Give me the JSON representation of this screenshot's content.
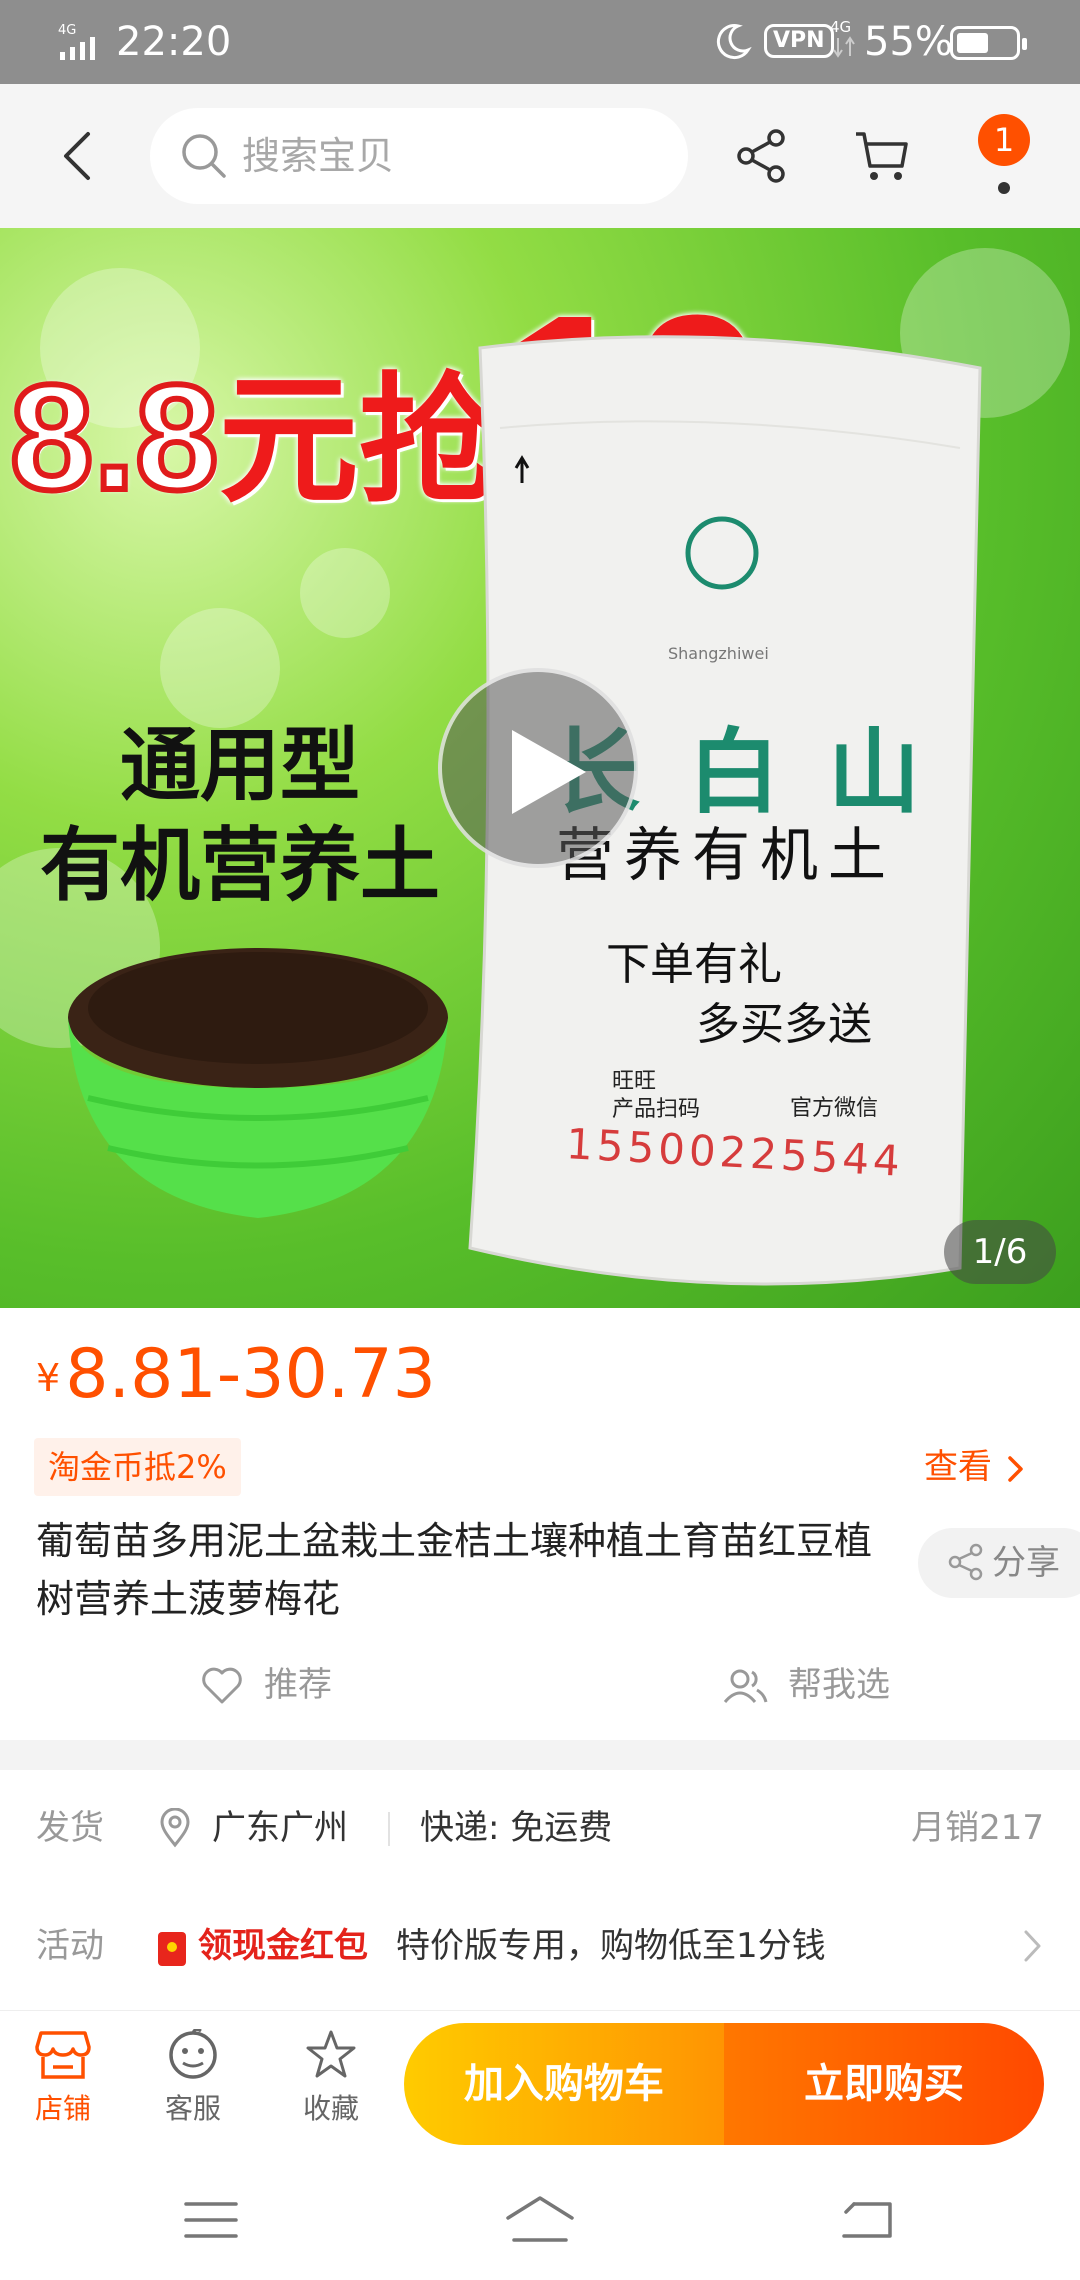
{
  "status_bar": {
    "network": "4G",
    "time": "22:20",
    "vpn": "VPN",
    "network2": "4G",
    "battery": "55%",
    "battery_level": 0.55
  },
  "top_nav": {
    "search_placeholder": "搜索宝贝",
    "cart_badge": "1"
  },
  "hero": {
    "promo_price": "8.8",
    "promo_mid": "元抢",
    "promo_big": "10",
    "promo_unit": "斤",
    "left_title_line1": "通用型",
    "left_title_line2": "有机营养土",
    "bag_brand": "长白山",
    "bag_pinyin": "Shangzhiwei",
    "bag_subtitle": "营养有机土",
    "bag_slogan1": "下单有礼",
    "bag_slogan2": "多买多送",
    "bag_small1": "旺旺\n产品扫码",
    "bag_small2": "官方微信",
    "bag_phone": "15500225544",
    "image_counter": "1/6"
  },
  "product": {
    "price_symbol": "¥",
    "price_range": "8.81-30.73",
    "coin_badge": "淘金币抵2%",
    "view_link": "查看",
    "title": "葡萄苗多用泥土盆栽土金桔土壤种植土育苗红豆植树营养土菠萝梅花",
    "share": "分享",
    "recommend": "推荐",
    "help_choose": "帮我选"
  },
  "shipping": {
    "label": "发货",
    "location": "广东广州",
    "express": "快递: 免运费",
    "monthly_sales": "月销217"
  },
  "promotion": {
    "label": "活动",
    "redpack": "领现金红包",
    "description": "特价版专用，购物低至1分钱"
  },
  "bottom_bar": {
    "shop": "店铺",
    "service": "客服",
    "favorite": "收藏",
    "add_to_cart": "加入购物车",
    "buy_now": "立即购买"
  },
  "colors": {
    "accent": "#ff5000",
    "cart_button": "#ffb300",
    "buy_button": "#ff5a00"
  }
}
